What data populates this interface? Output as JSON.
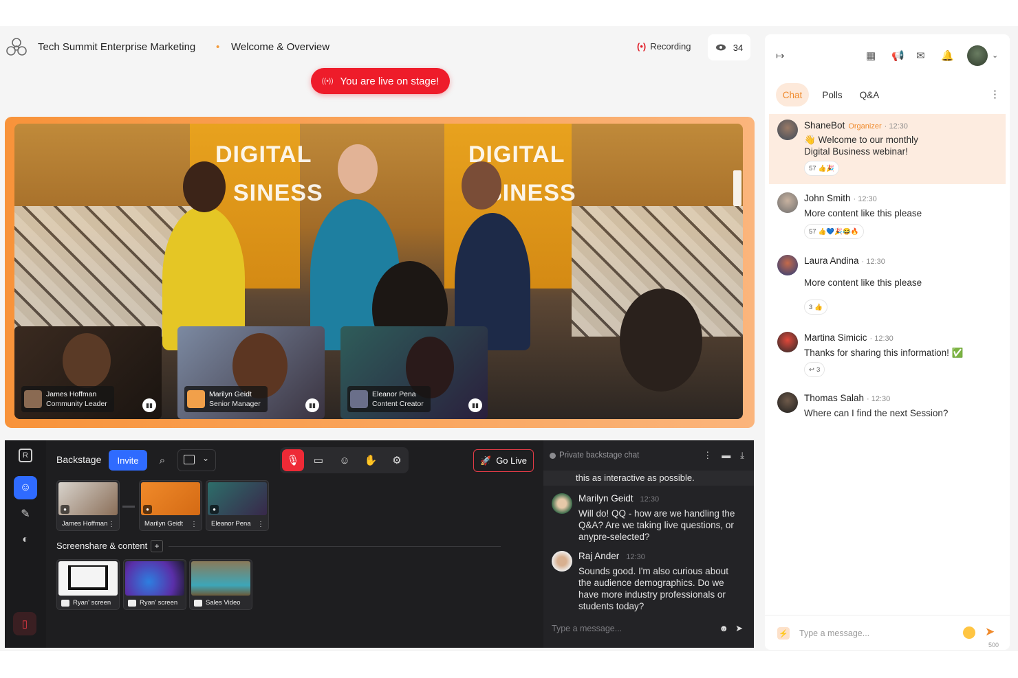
{
  "header": {
    "event_title": "Tech Summit Enterprise Marketing",
    "separator": "•",
    "session_title": "Welcome & Overview",
    "recording_label": "Recording",
    "viewer_count": "34",
    "live_banner": "You are live on stage!"
  },
  "stage": {
    "banner_left": "DIGITAL",
    "banner_left_2": "SINESS",
    "banner_right": "DIGITAL",
    "banner_right_2": "SINESS",
    "tiles": [
      {
        "name": "James Hoffman",
        "role": "Community Leader"
      },
      {
        "name": "Marilyn Geidt",
        "role": "Senior Manager"
      },
      {
        "name": "Eleanor Pena",
        "role": "Content Creator"
      }
    ]
  },
  "backstage": {
    "title": "Backstage",
    "invite_label": "Invite",
    "go_live_label": "Go Live",
    "participants": [
      {
        "name": "James Hoffman"
      },
      {
        "name": "Marilyn Geidt"
      },
      {
        "name": "Eleanor Pena"
      }
    ],
    "screenshare_label": "Screenshare & content",
    "screenshare_add": "+",
    "content": [
      {
        "name": "Ryan' screen"
      },
      {
        "name": "Ryan' screen"
      },
      {
        "name": "Sales Video"
      }
    ]
  },
  "private_chat": {
    "title": "Private backstage chat",
    "truncated_text": "this as interactive as possible.",
    "messages": [
      {
        "name": "Marilyn Geidt",
        "time": "12:30",
        "text": "Will do! QQ - how are we handling the Q&A? Are we taking live questions, or anypre-selected?"
      },
      {
        "name": "Raj Ander",
        "time": "12:30",
        "text": "Sounds good. I'm also curious about the audience demographics. Do we have more industry professionals or students today?"
      }
    ],
    "input_placeholder": "Type a message..."
  },
  "sidebar": {
    "tabs": [
      "Chat",
      "Polls",
      "Q&A"
    ],
    "messages": [
      {
        "name": "ShaneBot",
        "badge": "Organizer",
        "time": "· 12:30",
        "text": "👋 Welcome to our monthly Digital Business webinar!",
        "reaction_count": "57",
        "reactions": "👍🎉"
      },
      {
        "name": "John Smith",
        "time": "· 12:30",
        "text": "More content like this please",
        "reaction_count": "57",
        "reactions": "👍💙🎉😂🔥"
      },
      {
        "name": "Laura Andina",
        "time": "· 12:30",
        "text": "More content like this please",
        "reaction_count": "3",
        "reactions": "👍"
      },
      {
        "name": "Martina Simicic",
        "time": "· 12:30",
        "text": "Thanks for sharing this information! ✅",
        "reply_count": "3"
      },
      {
        "name": "Thomas Salah",
        "time": "· 12:30",
        "text": "Where can I find the next Session?"
      }
    ],
    "input_placeholder": "Type a message...",
    "char_limit": "500"
  },
  "colors": {
    "accent_orange": "#ef8a2c",
    "live_red": "#ee1c2a",
    "invite_blue": "#2f6bff",
    "panel_dark": "#1e1e20"
  },
  "icons": [
    "logo-icon",
    "recording-icon",
    "eye-icon",
    "collapse-icon",
    "calendar-icon",
    "megaphone-icon",
    "mail-icon",
    "bell-icon",
    "chevron-down-icon",
    "kebab-icon",
    "search-icon",
    "layout-icon",
    "mic-icon",
    "camera-icon",
    "emoji-icon",
    "hand-icon",
    "settings-icon",
    "rocket-icon",
    "send-icon",
    "bolt-icon"
  ]
}
